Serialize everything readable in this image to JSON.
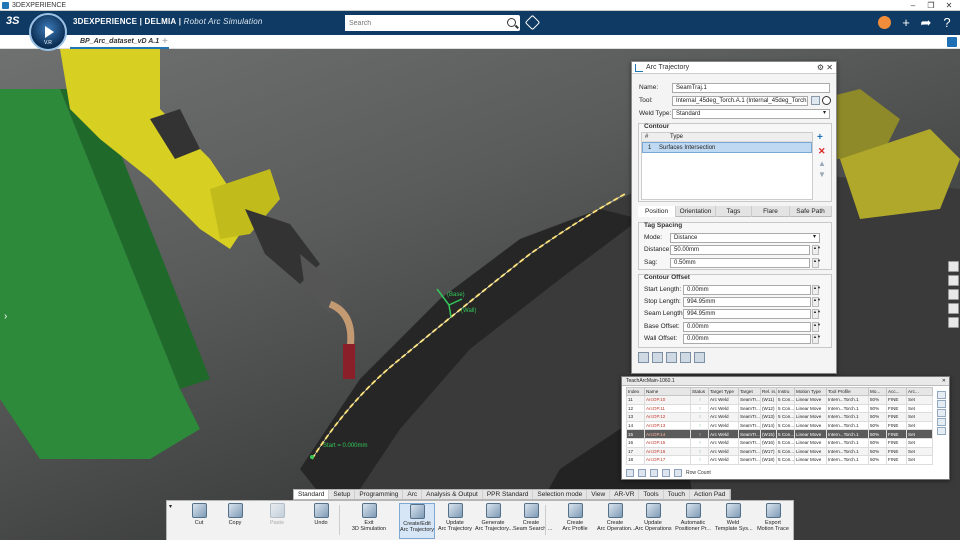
{
  "window": {
    "title": "3DEXPERIENCE"
  },
  "appbar": {
    "brand_strong": "3DEXPERIENCE | DELMIA",
    "brand_app": "Robot Arc Simulation",
    "compass_version": "V.R"
  },
  "search": {
    "placeholder": "Search"
  },
  "tab": {
    "label": "BP_Arc_dataset_vD A.1"
  },
  "dialog": {
    "title": "Arc Trajectory",
    "name_label": "Name:",
    "name_value": "SeamTraj.1",
    "tool_label": "Tool:",
    "tool_value": "Internal_45deg_Torch.A.1 (Internal_45deg_Torch.1)",
    "weld_label": "Weld Type:",
    "weld_value": "Standard",
    "contour_label": "Contour",
    "col_num": "#",
    "col_type": "Type",
    "contour_rows": [
      {
        "num": "1",
        "type": "Surfaces Intersection"
      }
    ],
    "tabs": [
      "Position",
      "Orientation",
      "Tags",
      "Flare",
      "Safe Path"
    ],
    "tag_spacing_label": "Tag Spacing",
    "mode_label": "Mode:",
    "mode_value": "Distance",
    "distance_label": "Distance:",
    "distance_value": "50.00mm",
    "sag_label": "Sag:",
    "sag_value": "0.50mm",
    "offset_label": "Contour Offset",
    "start_label": "Start Length:",
    "start_value": "0.00mm",
    "stop_label": "Stop Length:",
    "stop_value": "994.95mm",
    "seam_label": "Seam Length:",
    "seam_value": "994.95mm",
    "base_label": "Base Offset:",
    "base_value": "0.00mm",
    "wall_label": "Wall Offset:",
    "wall_value": "0.00mm"
  },
  "teach": {
    "title": "TeachArcMain-1060.1",
    "columns": [
      "Index",
      "Name",
      "Status",
      "Target Type",
      "Target",
      "Rel. in...",
      "Instru",
      "Motion Type",
      "Tool Profile",
      "Mo...",
      "Acc...",
      "Arc..."
    ],
    "rows": [
      [
        "11",
        "ArcOP.10",
        "↑",
        "Arc Weld",
        "SeamTr...",
        "(W11)",
        "5 Con...",
        "Linear Move",
        "Intern...Torch.1",
        "50%",
        "FINE",
        "Set"
      ],
      [
        "12",
        "ArcOP.11",
        "↑",
        "Arc Weld",
        "SeamTr...",
        "(W12)",
        "5 Con...",
        "Linear Move",
        "Intern...Torch.1",
        "50%",
        "FINE",
        "Set"
      ],
      [
        "13",
        "ArcOP.12",
        "↑",
        "Arc Weld",
        "SeamTr...",
        "(W13)",
        "5 Con...",
        "Linear Move",
        "Intern...Torch.1",
        "50%",
        "FINE",
        "Set"
      ],
      [
        "14",
        "ArcOP.13",
        "↑",
        "Arc Weld",
        "SeamTr...",
        "(W14)",
        "5 Con...",
        "Linear Move",
        "Intern...Torch.1",
        "50%",
        "FINE",
        "Set"
      ],
      [
        "15",
        "ArcOP.14",
        "↑",
        "Arc Weld",
        "SeamTr...",
        "(W15)",
        "5 Con...",
        "Linear Move",
        "Intern...Torch.1",
        "50%",
        "FINE",
        "Set"
      ],
      [
        "16",
        "ArcOP.15",
        "↑",
        "Arc Weld",
        "SeamTr...",
        "(W16)",
        "5 Con...",
        "Linear Move",
        "Intern...Torch.1",
        "50%",
        "FINE",
        "Set"
      ],
      [
        "17",
        "ArcOP.16",
        "↑",
        "Arc Weld",
        "SeamTr...",
        "(W17)",
        "5 Con...",
        "Linear Move",
        "Intern...Torch.1",
        "50%",
        "FINE",
        "Set"
      ],
      [
        "18",
        "ArcOP.17",
        "↑",
        "Arc Weld",
        "SeamTr...",
        "(W18)",
        "5 Con...",
        "Linear Move",
        "Intern...Torch.1",
        "50%",
        "FINE",
        "Set"
      ]
    ],
    "footer_label": "Row Count"
  },
  "viewport": {
    "base_label": "(Base)",
    "wall_label": "(Wall)",
    "start_label": "Start = 0.000mm"
  },
  "actionbar": {
    "tabs": [
      "Standard",
      "Setup",
      "Programming",
      "Arc",
      "Analysis & Output",
      "PPR Standard",
      "Selection mode",
      "View",
      "AR-VR",
      "Tools",
      "Touch",
      "Action Pad"
    ],
    "buttons": [
      {
        "label1": "Cut",
        "label2": ""
      },
      {
        "label1": "Copy",
        "label2": ""
      },
      {
        "label1": "Paste",
        "label2": ""
      },
      {
        "label1": "Undo",
        "label2": ""
      },
      {
        "label1": "Exit",
        "label2": "3D Simulation"
      },
      {
        "label1": "Create/Edit",
        "label2": "Arc Trajectory"
      },
      {
        "label1": "Update",
        "label2": "Arc Trajectory"
      },
      {
        "label1": "Generate",
        "label2": "Arc Trajectory..."
      },
      {
        "label1": "Create",
        "label2": "Seam Search ..."
      },
      {
        "label1": "Create",
        "label2": "Arc Profile"
      },
      {
        "label1": "Create",
        "label2": "Arc Operation..."
      },
      {
        "label1": "Update",
        "label2": "Arc Operations"
      },
      {
        "label1": "Automatic",
        "label2": "Positioner Pr..."
      },
      {
        "label1": "Weld",
        "label2": "Template Sys..."
      },
      {
        "label1": "Export",
        "label2": "Motion Trace"
      }
    ]
  }
}
